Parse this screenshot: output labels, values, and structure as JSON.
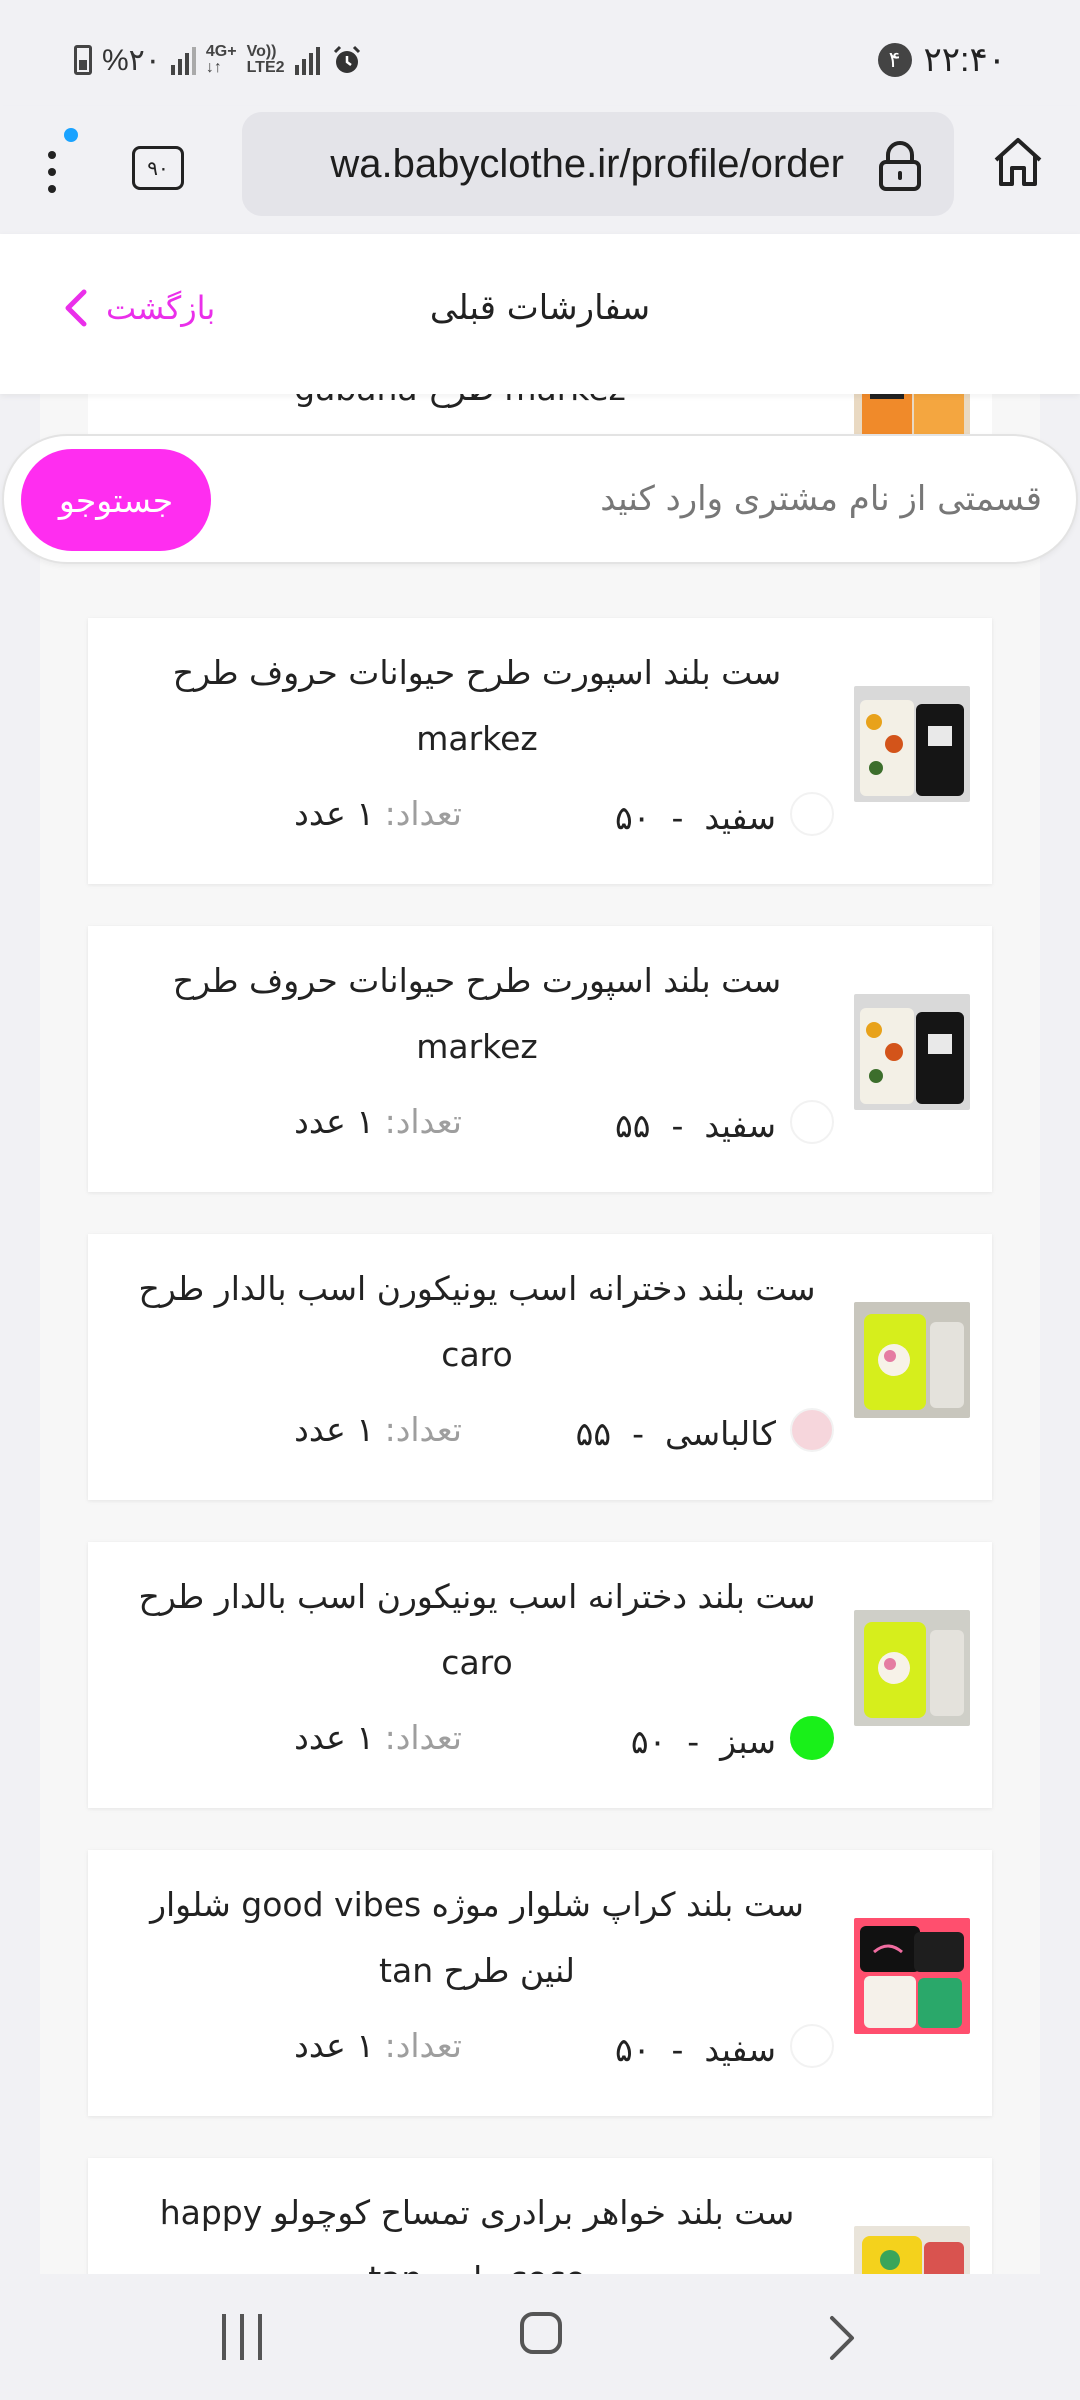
{
  "status_bar": {
    "time": "۲۲:۴۰",
    "notification_count": "۴",
    "battery": "%۲۰",
    "network_label_top": "4G+",
    "network_label_bottom": "↓↑",
    "volte_top": "Vo))",
    "volte_bottom": "LTE2"
  },
  "browser": {
    "url": "wa.babyclothe.ir/profile/order",
    "tabs_count": "۹۰"
  },
  "header": {
    "title": "سفارشات قبلی",
    "back_label": "بازگشت"
  },
  "search": {
    "placeholder": "قسمتی از نام مشتری وارد کنید",
    "button_label": "جستوجو"
  },
  "partial_item": {
    "title": "markez طرح gabana"
  },
  "qty_label": "تعداد:",
  "orders": [
    {
      "title": "ست بلند اسپورت طرح حیوانات حروف طرح markez",
      "color_name": "سفید",
      "size": "۵۰",
      "swatch": "#ffffff",
      "quantity": "۱ عدد"
    },
    {
      "title": "ست بلند اسپورت طرح حیوانات حروف طرح markez",
      "color_name": "سفید",
      "size": "۵۵",
      "swatch": "#ffffff",
      "quantity": "۱ عدد"
    },
    {
      "title": "ست بلند دخترانه اسب یونیکورن اسب بالدار طرح caro",
      "color_name": "کالباسی",
      "size": "۵۵",
      "swatch": "#f6d6dc",
      "quantity": "۱ عدد"
    },
    {
      "title": "ست بلند دخترانه اسب یونیکورن اسب بالدار طرح caro",
      "color_name": "سبز",
      "size": "۵۰",
      "swatch": "#19f019",
      "quantity": "۱ عدد"
    },
    {
      "title": "ست بلند کراپ شلوار موژه good vibes شلوار لنین طرح tan",
      "color_name": "سفید",
      "size": "۵۰",
      "swatch": "#ffffff",
      "quantity": "۱ عدد"
    },
    {
      "title": "ست بلند خواهر برادری تمساح کوچولو happy coco طرح tan",
      "color_name": "",
      "size": "",
      "swatch": "",
      "quantity": ""
    }
  ],
  "colors": {
    "accent": "#ff2df0",
    "back_link": "#ea2fea",
    "browser_chrome": "#f1f1f4",
    "url_field": "#e4e4e9",
    "notification_dot": "#1aa3ff"
  }
}
